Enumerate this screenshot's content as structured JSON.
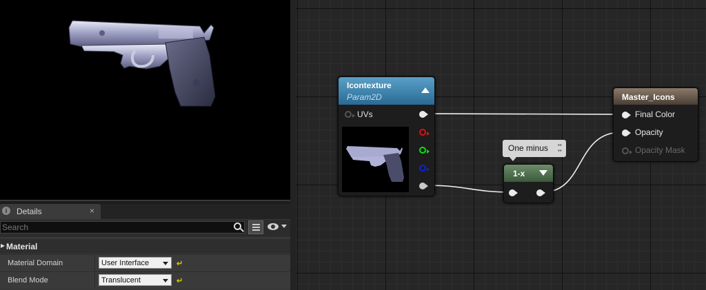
{
  "details": {
    "tab_label": "Details",
    "tab_close": "×",
    "search_placeholder": "Search",
    "section": "Material",
    "properties": [
      {
        "name": "Material Domain",
        "value": "User Interface"
      },
      {
        "name": "Blend Mode",
        "value": "Translucent"
      }
    ],
    "reset_glyph": "↵"
  },
  "graph": {
    "texture_node": {
      "title": "Icontexture",
      "subtitle": "Param2D",
      "input_label": "UVs"
    },
    "comment": {
      "text": "One minus"
    },
    "oneminus_node": {
      "title": "1-x"
    },
    "master_node": {
      "title": "Master_Icons",
      "inputs": [
        {
          "label": "Final Color",
          "connected": true
        },
        {
          "label": "Opacity",
          "connected": true
        },
        {
          "label": "Opacity Mask",
          "connected": false
        }
      ]
    }
  }
}
